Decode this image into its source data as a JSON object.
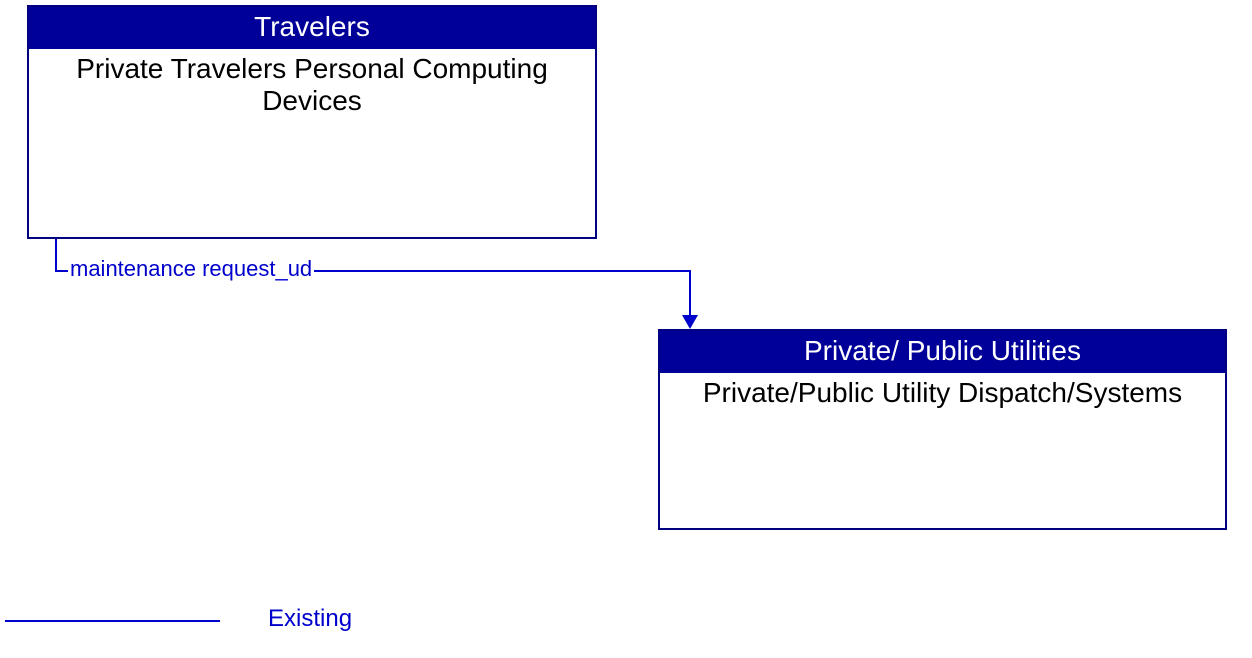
{
  "entities": {
    "top": {
      "header": "Travelers",
      "body": "Private Travelers Personal Computing Devices"
    },
    "bottom": {
      "header": "Private/ Public Utilities",
      "body": "Private/Public Utility Dispatch/Systems"
    }
  },
  "connector": {
    "label": "maintenance request_ud"
  },
  "legend": {
    "label": "Existing"
  }
}
